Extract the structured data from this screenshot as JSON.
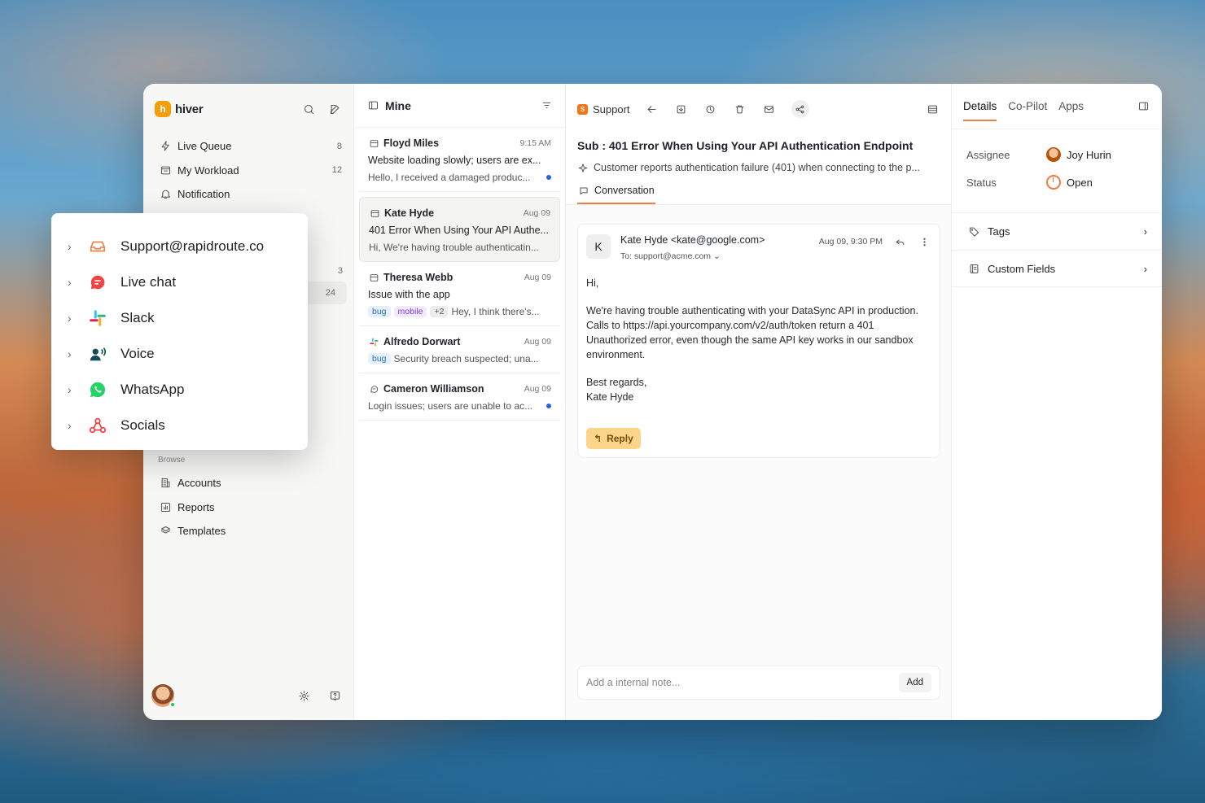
{
  "brand": {
    "name": "hiver",
    "logo_letter": "h"
  },
  "sidebar": {
    "items": [
      {
        "label": "Live Queue",
        "count": "8",
        "icon": "bolt-icon"
      },
      {
        "label": "My Workload",
        "count": "12",
        "icon": "inbox-icon"
      },
      {
        "label": "Notification",
        "count": "",
        "icon": "bell-icon"
      }
    ],
    "hidden_counts": [
      "3",
      "24"
    ],
    "browse_label": "Browse",
    "browse_items": [
      {
        "label": "Accounts",
        "icon": "building-icon"
      },
      {
        "label": "Reports",
        "icon": "chart-icon"
      },
      {
        "label": "Templates",
        "icon": "layers-icon"
      }
    ]
  },
  "channels_popover": {
    "items": [
      {
        "label": "Support@rapidroute.co",
        "icon": "mailbox-icon",
        "color": "#e8824a"
      },
      {
        "label": "Live chat",
        "icon": "chat-icon",
        "color": "#ef4444"
      },
      {
        "label": "Slack",
        "icon": "slack-icon",
        "color": "#36c5f0"
      },
      {
        "label": "Voice",
        "icon": "voice-icon",
        "color": "#0f4c5c"
      },
      {
        "label": "WhatsApp",
        "icon": "whatsapp-icon",
        "color": "#25d366"
      },
      {
        "label": "Socials",
        "icon": "socials-icon",
        "color": "#ef4444"
      }
    ]
  },
  "list": {
    "title": "Mine",
    "messages": [
      {
        "from": "Floyd Miles",
        "time": "9:15 AM",
        "subject": "Website loading slowly; users are ex...",
        "preview": "Hello, I received a damaged produc...",
        "unread": true,
        "channel": "email-icon"
      },
      {
        "from": "Kate Hyde",
        "time": "Aug 09",
        "subject": "401 Error When Using Your API Authe...",
        "preview": "Hi, We're having trouble authenticatin...",
        "unread": false,
        "channel": "email-icon",
        "active": true
      },
      {
        "from": "Theresa Webb",
        "time": "Aug 09",
        "subject": "Issue with the app",
        "tags": [
          "bug",
          "mobile",
          "+2"
        ],
        "preview": "Hey, I think there's...",
        "channel": "email-icon"
      },
      {
        "from": "Alfredo Dorwart",
        "time": "Aug 09",
        "tags": [
          "bug"
        ],
        "preview": "Security breach suspected; una...",
        "channel": "slack-icon"
      },
      {
        "from": "Cameron Williamson",
        "time": "Aug 09",
        "preview": "Login issues; users are unable to ac...",
        "unread": true,
        "channel": "chat-icon"
      }
    ]
  },
  "conversation": {
    "inbox_label": "Support",
    "inbox_badge": "S",
    "subject": "Sub : 401 Error When Using Your API Authentication Endpoint",
    "summary": "Customer reports authentication failure (401) when connecting to the p...",
    "tab": "Conversation",
    "email": {
      "avatar_letter": "K",
      "from": "Kate Hyde <kate@google.com>",
      "to": "To: support@acme.com",
      "time": "Aug 09, 9:30 PM",
      "greeting": "Hi,",
      "body": "We're having trouble authenticating with your DataSync API in production. Calls to https://api.yourcompany.com/v2/auth/token return a 401 Unauthorized error, even though the same API key works in our sandbox environment.",
      "signoff": "Best regards,",
      "signature": "Kate Hyde",
      "reply_label": "Reply"
    },
    "note_placeholder": "Add a internal note...",
    "add_label": "Add"
  },
  "details": {
    "tabs": [
      "Details",
      "Co-Pilot",
      "Apps"
    ],
    "assignee_label": "Assignee",
    "assignee": "Joy Hurin",
    "status_label": "Status",
    "status": "Open",
    "tags_label": "Tags",
    "custom_fields_label": "Custom Fields"
  }
}
